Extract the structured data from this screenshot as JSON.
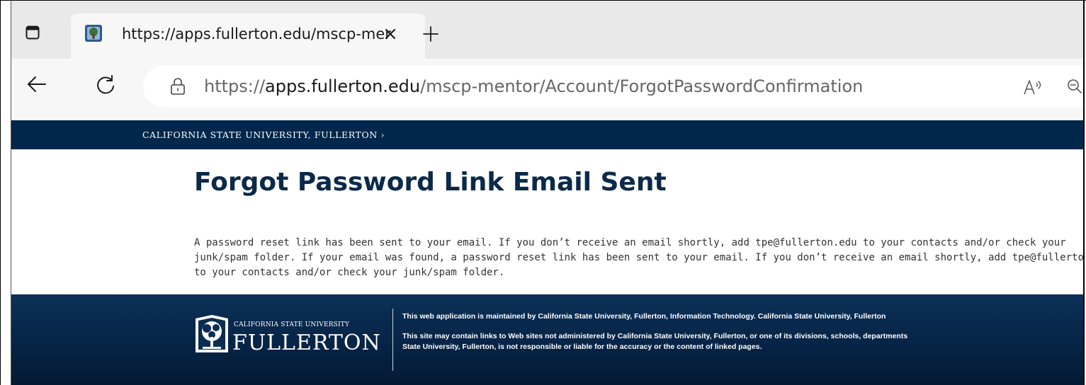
{
  "browser": {
    "tab": {
      "title": "https://apps.fullerton.edu/mscp-mentor/Account/ForgotPasswordConfirmation"
    },
    "address_bar": {
      "url_prefix": "https://",
      "url_host": "apps.fullerton.edu",
      "url_path": "/mscp-mentor/Account/ForgotPasswordConfirmation"
    },
    "icons": {
      "tab_actions": "tab-actions-icon",
      "favicon": "csuf-favicon-icon",
      "close": "close-icon",
      "new_tab": "plus-icon",
      "back": "back-arrow-icon",
      "refresh": "refresh-icon",
      "lock": "lock-icon",
      "read_aloud": "read-aloud-icon",
      "zoom": "zoom-out-icon"
    }
  },
  "page": {
    "header_link": "CALIFORNIA STATE UNIVERSITY, FULLERTON ›",
    "title": "Forgot Password Link Email Sent",
    "message": "A password reset link has been sent to your email. If you don’t receive an email shortly, add tpe@fullerton.edu to your contacts and/or check your junk/spam folder. If your email was found, a password reset link has been sent to your email. If you don’t receive an email shortly, add tpe@fullerton.edu to your contacts and/or check your junk/spam folder.",
    "footer": {
      "logo_small": "CALIFORNIA STATE UNIVERSITY",
      "logo_big": "FULLERTON",
      "line1": "This web application is maintained by California State University, Fullerton, Information Technology. California State University, Fullerton",
      "line2a": "This site may contain links to Web sites not administered by California State University, Fullerton, or one of its divisions, schools, departments",
      "line2b": "State University, Fullerton, is not responsible or liable for the accuracy or the content of linked pages."
    }
  },
  "colors": {
    "brand_navy": "#00274c",
    "title_navy": "#0b2a4a"
  }
}
